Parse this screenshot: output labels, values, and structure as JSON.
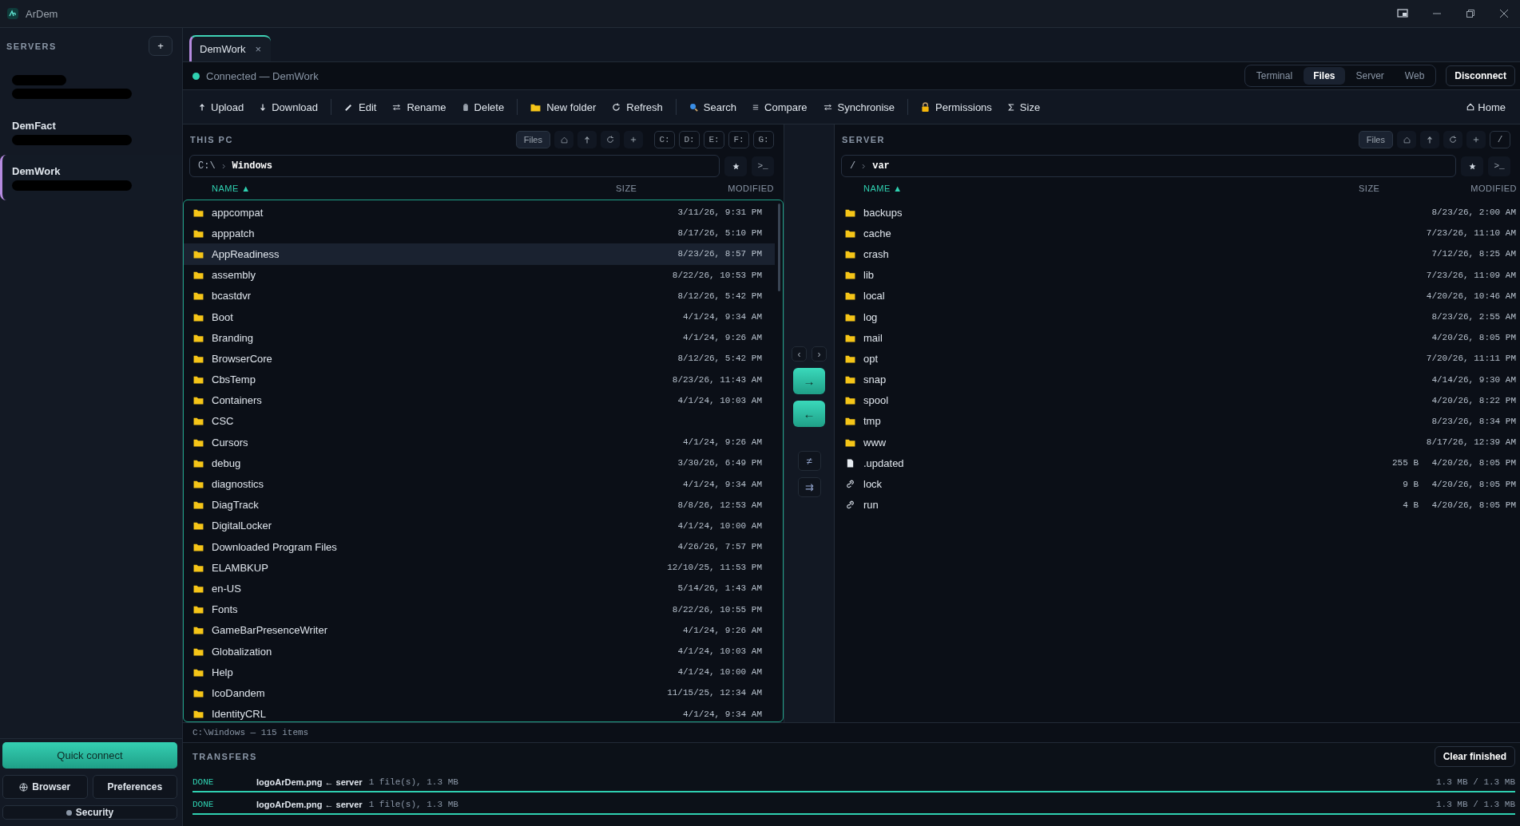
{
  "app": {
    "title": "ArDem"
  },
  "sidebar": {
    "heading": "SERVERS",
    "add_button": "+",
    "servers": [
      {
        "name_hidden": true,
        "selected": false
      },
      {
        "name": "DemFact",
        "name_hidden": false,
        "selected": false
      },
      {
        "name": "DemWork",
        "name_hidden": false,
        "selected": true
      }
    ],
    "quick_connect": "Quick connect",
    "browser": "Browser",
    "preferences": "Preferences",
    "security": "Security"
  },
  "session_tab": {
    "label": "DemWork",
    "close": "×",
    "selected": true
  },
  "connection": {
    "status": "Connected — DemWork",
    "connected": true
  },
  "view_tabs": [
    {
      "label": "Terminal",
      "selected": false
    },
    {
      "label": "Files",
      "selected": true
    },
    {
      "label": "Server",
      "selected": false
    },
    {
      "label": "Web",
      "selected": false
    }
  ],
  "disconnect": "Disconnect",
  "toolbar": [
    {
      "label": "Upload"
    },
    {
      "label": "Download"
    },
    {
      "label": "Edit"
    },
    {
      "label": "Rename"
    },
    {
      "label": "Delete"
    },
    {
      "label": "New folder"
    },
    {
      "label": "Refresh"
    },
    {
      "label": "Search"
    },
    {
      "label": "Compare"
    },
    {
      "label": "Synchronise"
    },
    {
      "label": "Permissions"
    },
    {
      "label": "Size"
    }
  ],
  "home": "Home",
  "local": {
    "heading": "THIS PC",
    "files_button": "Files",
    "drives": [
      "C:",
      "D:",
      "E:",
      "F:",
      "G:"
    ],
    "path_root": "C:\\",
    "path_dir": "Windows",
    "terminal_button": ">_",
    "columns": {
      "name": "NAME ▲",
      "size": "SIZE",
      "modified": "MODIFIED"
    },
    "rows": [
      {
        "kind": "folder",
        "name": "appcompat",
        "modified": "3/11/26, 9:31 PM",
        "selected": false
      },
      {
        "kind": "folder",
        "name": "apppatch",
        "modified": "8/17/26, 5:10 PM",
        "selected": false
      },
      {
        "kind": "folder",
        "name": "AppReadiness",
        "modified": "8/23/26, 8:57 PM",
        "selected": true
      },
      {
        "kind": "folder",
        "name": "assembly",
        "modified": "8/22/26, 10:53 PM",
        "selected": false
      },
      {
        "kind": "folder",
        "name": "bcastdvr",
        "modified": "8/12/26, 5:42 PM",
        "selected": false
      },
      {
        "kind": "folder",
        "name": "Boot",
        "modified": "4/1/24, 9:34 AM",
        "selected": false
      },
      {
        "kind": "folder",
        "name": "Branding",
        "modified": "4/1/24, 9:26 AM",
        "selected": false
      },
      {
        "kind": "folder",
        "name": "BrowserCore",
        "modified": "8/12/26, 5:42 PM",
        "selected": false
      },
      {
        "kind": "folder",
        "name": "CbsTemp",
        "modified": "8/23/26, 11:43 AM",
        "selected": false
      },
      {
        "kind": "folder",
        "name": "Containers",
        "modified": "4/1/24, 10:03 AM",
        "selected": false
      },
      {
        "kind": "folder",
        "name": "CSC",
        "selected": false
      },
      {
        "kind": "folder",
        "name": "Cursors",
        "modified": "4/1/24, 9:26 AM",
        "selected": false
      },
      {
        "kind": "folder",
        "name": "debug",
        "modified": "3/30/26, 6:49 PM",
        "selected": false
      },
      {
        "kind": "folder",
        "name": "diagnostics",
        "modified": "4/1/24, 9:34 AM",
        "selected": false
      },
      {
        "kind": "folder",
        "name": "DiagTrack",
        "modified": "8/8/26, 12:53 AM",
        "selected": false
      },
      {
        "kind": "folder",
        "name": "DigitalLocker",
        "modified": "4/1/24, 10:00 AM",
        "selected": false
      },
      {
        "kind": "folder",
        "name": "Downloaded Program Files",
        "modified": "4/26/26, 7:57 PM",
        "selected": false
      },
      {
        "kind": "folder",
        "name": "ELAMBKUP",
        "modified": "12/10/25, 11:53 PM",
        "selected": false
      },
      {
        "kind": "folder",
        "name": "en-US",
        "modified": "5/14/26, 1:43 AM",
        "selected": false
      },
      {
        "kind": "folder",
        "name": "Fonts",
        "modified": "8/22/26, 10:55 PM",
        "selected": false
      },
      {
        "kind": "folder",
        "name": "GameBarPresenceWriter",
        "modified": "4/1/24, 9:26 AM",
        "selected": false
      },
      {
        "kind": "folder",
        "name": "Globalization",
        "modified": "4/1/24, 10:03 AM",
        "selected": false
      },
      {
        "kind": "folder",
        "name": "Help",
        "modified": "4/1/24, 10:00 AM",
        "selected": false
      },
      {
        "kind": "folder",
        "name": "IcoDandem",
        "modified": "11/15/25, 12:34 AM",
        "selected": false
      },
      {
        "kind": "folder",
        "name": "IdentityCRL",
        "modified": "4/1/24, 9:34 AM",
        "selected": false
      }
    ],
    "status": "C:\\Windows — 115 items"
  },
  "middle": {
    "prev": "‹",
    "next": "›",
    "upload": "→",
    "download": "←",
    "compare": "≠",
    "sync": "⇉"
  },
  "remote": {
    "heading": "SERVER",
    "files_button": "Files",
    "root_button": "/",
    "path_root": "/",
    "path_dir": "var",
    "terminal_button": ">_",
    "columns": {
      "name": "NAME ▲",
      "size": "SIZE",
      "modified": "MODIFIED"
    },
    "rows": [
      {
        "kind": "folder",
        "name": "backups",
        "modified": "8/23/26, 2:00 AM"
      },
      {
        "kind": "folder",
        "name": "cache",
        "modified": "7/23/26, 11:10 AM"
      },
      {
        "kind": "folder",
        "name": "crash",
        "modified": "7/12/26, 8:25 AM"
      },
      {
        "kind": "folder",
        "name": "lib",
        "modified": "7/23/26, 11:09 AM"
      },
      {
        "kind": "folder",
        "name": "local",
        "modified": "4/20/26, 10:46 AM"
      },
      {
        "kind": "folder",
        "name": "log",
        "modified": "8/23/26, 2:55 AM"
      },
      {
        "kind": "folder",
        "name": "mail",
        "modified": "4/20/26, 8:05 PM"
      },
      {
        "kind": "folder",
        "name": "opt",
        "modified": "7/20/26, 11:11 PM"
      },
      {
        "kind": "folder",
        "name": "snap",
        "modified": "4/14/26, 9:30 AM"
      },
      {
        "kind": "folder",
        "name": "spool",
        "modified": "4/20/26, 8:22 PM"
      },
      {
        "kind": "folder",
        "name": "tmp",
        "modified": "8/23/26, 8:34 PM"
      },
      {
        "kind": "folder",
        "name": "www",
        "modified": "8/17/26, 12:39 AM"
      },
      {
        "kind": "file",
        "name": ".updated",
        "size": "255 B",
        "modified": "4/20/26, 8:05 PM"
      },
      {
        "kind": "link",
        "name": "lock",
        "size": "9 B",
        "modified": "4/20/26, 8:05 PM"
      },
      {
        "kind": "link",
        "name": "run",
        "size": "4 B",
        "modified": "4/20/26, 8:05 PM"
      }
    ]
  },
  "transfers": {
    "heading": "TRANSFERS",
    "clear_button": "Clear finished",
    "items": [
      {
        "status": "DONE",
        "name": "logoArDem.png ← server",
        "detail": "1 file(s), 1.3 MB",
        "amount": "1.3 MB / 1.3 MB",
        "level": 1
      },
      {
        "status": "DONE",
        "name": "logoArDem.png ← server",
        "detail": "1 file(s), 1.3 MB",
        "amount": "1.3 MB / 1.3 MB",
        "level": 1
      }
    ]
  }
}
